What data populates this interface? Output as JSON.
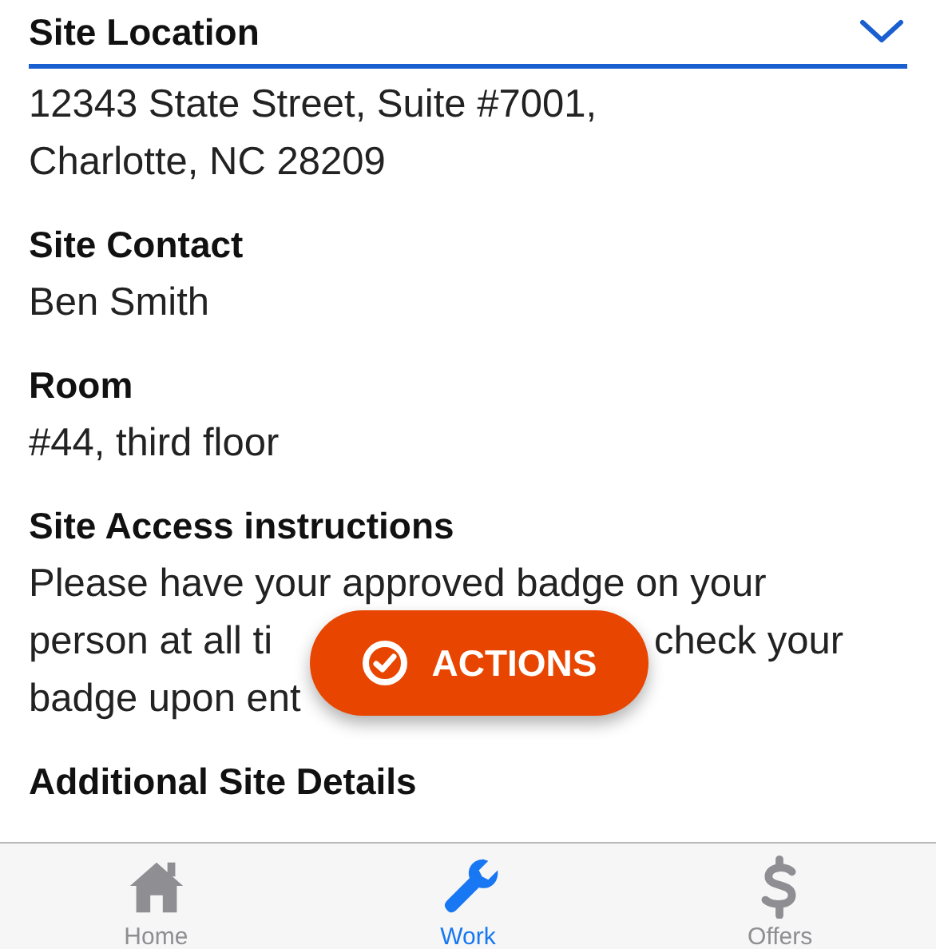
{
  "header": {
    "title": "Site Location"
  },
  "address_lines": [
    "12343 State Street, Suite #7001,",
    "Charlotte, NC 28209"
  ],
  "fields": [
    {
      "label": "Site Contact",
      "value": "Ben Smith"
    },
    {
      "label": "Room",
      "value": "#44, third floor"
    }
  ],
  "access": {
    "label": "Site Access instructions",
    "lines": [
      [
        "Please have your approved badge on your"
      ],
      [
        "person at all ti",
        "check your"
      ],
      [
        "badge upon ent"
      ]
    ]
  },
  "next_section": {
    "label": "Additional Site Details"
  },
  "action_button": {
    "label": "ACTIONS"
  },
  "tab_bar": [
    {
      "label": "Home",
      "kind": "home",
      "selected": false
    },
    {
      "label": "Work",
      "kind": "wrench",
      "selected": true
    },
    {
      "label": "Offers",
      "kind": "dollar",
      "selected": false
    }
  ]
}
